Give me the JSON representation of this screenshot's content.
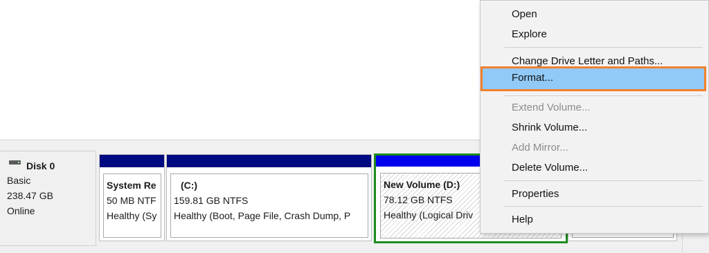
{
  "disk": {
    "name": "Disk 0",
    "type": "Basic",
    "size": "238.47 GB",
    "status": "Online"
  },
  "partitions": [
    {
      "name": "System Re",
      "size": "50 MB NTF",
      "status": "Healthy (Sy"
    },
    {
      "name": "(C:)",
      "size": "159.81 GB NTFS",
      "status": "Healthy (Boot, Page File, Crash Dump, P"
    },
    {
      "name": "New Volume  (D:)",
      "size": "78.12 GB NTFS",
      "status": "Healthy (Logical Driv"
    }
  ],
  "menu": {
    "open": "Open",
    "explore": "Explore",
    "change_drive_letter": "Change Drive Letter and Paths...",
    "format": "Format...",
    "extend_volume": "Extend Volume...",
    "shrink_volume": "Shrink Volume...",
    "add_mirror": "Add Mirror...",
    "delete_volume": "Delete Volume...",
    "properties": "Properties",
    "help": "Help"
  },
  "colors": {
    "partition_bar": "#000a80",
    "selected_partition_bar": "#0000ee",
    "selection_border": "#1e8c1e",
    "menu_highlight": "#91c9f7",
    "annotation_outline": "#f2812b"
  }
}
